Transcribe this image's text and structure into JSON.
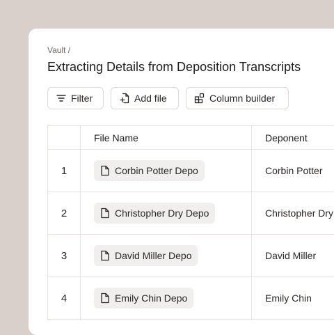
{
  "breadcrumb": "Vault /",
  "page_title": "Extracting Details from Deposition Transcripts",
  "toolbar": {
    "filter_label": "Filter",
    "add_file_label": "Add file",
    "column_builder_label": "Column builder"
  },
  "table": {
    "headers": {
      "index": "",
      "file_name": "File Name",
      "deponent": "Deponent"
    },
    "rows": [
      {
        "index": "1",
        "file_name": "Corbin Potter Depo",
        "deponent": "Corbin Potter"
      },
      {
        "index": "2",
        "file_name": "Christopher Dry Depo",
        "deponent": "Christopher Dry"
      },
      {
        "index": "3",
        "file_name": "David Miller Depo",
        "deponent": "David Miller"
      },
      {
        "index": "4",
        "file_name": "Emily Chin Depo",
        "deponent": "Emily Chin"
      }
    ]
  },
  "icons": {
    "filter": "filter-icon",
    "add_file": "add-file-icon",
    "column_builder": "column-builder-icon",
    "document": "document-icon"
  },
  "colors": {
    "background": "#d9cfcb",
    "card": "#ffffff",
    "chip": "#f1efed",
    "border": "#e6e2df",
    "text": "#1e1c1b"
  }
}
